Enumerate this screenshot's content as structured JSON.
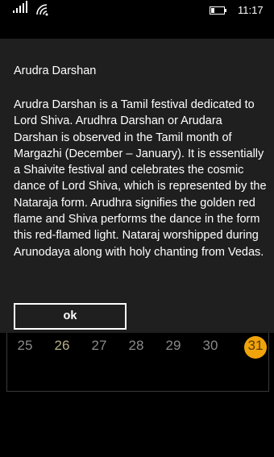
{
  "status_bar": {
    "time": "11:17",
    "signal_icon": "signal-strength-icon",
    "wifi_icon": "wifi-icon",
    "battery_icon": "battery-icon"
  },
  "calendar_background": {
    "days": [
      "25",
      "26",
      "27",
      "28",
      "29",
      "30",
      "31"
    ],
    "highlighted_day": "26",
    "today": "31",
    "today_color": "#f0a30a"
  },
  "dialog": {
    "title": "Arudra Darshan",
    "body": "Arudra Darshan is a Tamil festival dedicated to Lord Shiva. Arudhra Darshan or Arudara Darshan is observed in the Tamil month of Margazhi (December – January). It is essentially a Shaivite festival and celebrates the cosmic dance of Lord Shiva, which is represented by the Nataraja form. Arudhra signifies the golden red flame and Shiva performs the dance in the form this red-flamed light. Nataraj worshipped during Arunodaya along with holy chanting from Vedas.",
    "ok_label": "ok"
  }
}
